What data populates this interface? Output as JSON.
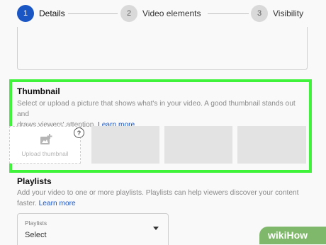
{
  "stepper": {
    "steps": [
      {
        "number": "1",
        "label": "Details",
        "state": "active"
      },
      {
        "number": "2",
        "label": "Video elements",
        "state": "inactive"
      },
      {
        "number": "3",
        "label": "Visibility",
        "state": "inactive"
      }
    ]
  },
  "thumbnail": {
    "title": "Thumbnail",
    "description_line1": "Select or upload a picture that shows what's in your video. A good thumbnail stands out and",
    "description_line2": "draws viewers' attention.",
    "learn_more": "Learn more",
    "upload_label": "Upload thumbnail",
    "help_glyph": "?",
    "upload_icon": "add-photo-icon"
  },
  "playlists": {
    "title": "Playlists",
    "description_line1": "Add your video to one or more playlists. Playlists can help viewers discover your content",
    "description_line2": "faster.",
    "learn_more": "Learn more",
    "select_label": "Playlists",
    "select_value": "Select"
  },
  "watermark": {
    "text": "wikiHow"
  },
  "colors": {
    "accent": "#1a56c4",
    "highlight": "#3ff23a",
    "placeholder": "#e3e3e3"
  }
}
